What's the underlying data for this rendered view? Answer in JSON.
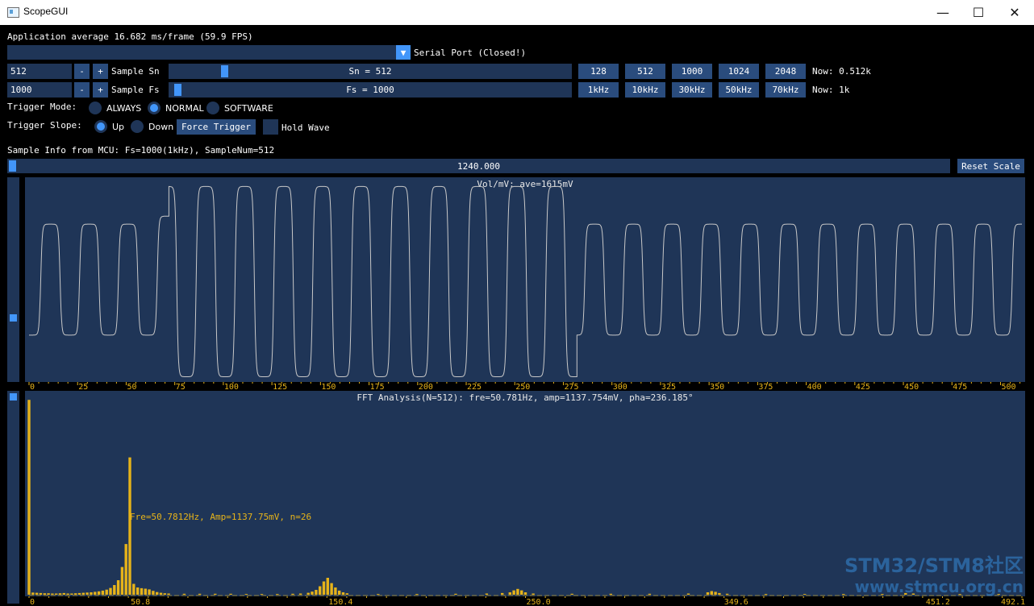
{
  "window": {
    "title": "ScopeGUI",
    "minimize_glyph": "—",
    "maximize_glyph": "☐",
    "close_glyph": "✕"
  },
  "header": {
    "fps_text": "Application average 16.682 ms/frame (59.9 FPS)"
  },
  "serial": {
    "combo_value": "",
    "arrow_glyph": "▼",
    "label": "Serial Port (Closed!)"
  },
  "sample_sn": {
    "value": "512",
    "minus": "-",
    "plus": "+",
    "label": "Sample Sn",
    "slider_text": "Sn = 512",
    "slider_fraction": 0.13,
    "presets": [
      "128",
      "512",
      "1000",
      "1024",
      "2048"
    ],
    "now_text": "Now: 0.512k"
  },
  "sample_fs": {
    "value": "1000",
    "minus": "-",
    "plus": "+",
    "label": "Sample Fs",
    "slider_text": "Fs = 1000",
    "slider_fraction": 0.01,
    "presets": [
      "1kHz",
      "10kHz",
      "30kHz",
      "50kHz",
      "70kHz"
    ],
    "now_text": "Now: 1k"
  },
  "trigger_mode": {
    "label": "Trigger Mode:",
    "options": [
      "ALWAYS",
      "NORMAL",
      "SOFTWARE"
    ],
    "selected": "NORMAL"
  },
  "trigger_slope": {
    "label": "Trigger Slope:",
    "options": [
      "Up",
      "Down"
    ],
    "selected": "Up",
    "force_button": "Force Trigger",
    "hold_label": "Hold Wave",
    "hold_checked": false
  },
  "sample_info": "Sample Info from MCU: Fs=1000(1kHz), SampleNum=512",
  "scale": {
    "slider_text": "1240.000",
    "slider_fraction": 0.0,
    "reset_button": "Reset Scale"
  },
  "colors": {
    "frame_bg": "#1f3557",
    "button": "#2a4c7d",
    "accent": "#4296fa",
    "plot_line": "#c8c8c8",
    "fft_bar": "#e6b31a"
  },
  "chart_data": [
    {
      "type": "line",
      "title": "Vol/mV: ave=1615mV",
      "x_ticks": [
        "0",
        "25",
        "50",
        "75",
        "100",
        "125",
        "150",
        "175",
        "200",
        "225",
        "250",
        "275",
        "300",
        "325",
        "350",
        "375",
        "400",
        "425",
        "450",
        "475",
        "500"
      ],
      "xlim": [
        0,
        511
      ],
      "series": [
        {
          "segments": [
            {
              "x_start": 0,
              "x_end": 62,
              "period": 20,
              "high": 0.78,
              "low": 0.22
            },
            {
              "x_start": 62,
              "x_end": 72,
              "period": 20,
              "high": 0.82,
              "low": 0.22
            },
            {
              "x_start": 72,
              "x_end": 282,
              "period": 20,
              "high": 0.97,
              "low": 0.01
            },
            {
              "x_start": 282,
              "x_end": 511,
              "period": 20,
              "high": 0.78,
              "low": 0.22
            }
          ]
        }
      ]
    },
    {
      "type": "bar",
      "title": "FFT Analysis(N=512): fre=50.781Hz, amp=1137.754mV, pha=236.185°",
      "annotation": "Fre=50.7812Hz, Amp=1137.75mV, n=26",
      "x_ticks": [
        "0",
        "50.8",
        "150.4",
        "250.0",
        "349.6",
        "451.2",
        "492.1"
      ],
      "xlim": [
        0,
        500
      ],
      "bins": [
        {
          "n": 0,
          "amp": 1615
        },
        {
          "n": 1,
          "amp": 18
        },
        {
          "n": 2,
          "amp": 16
        },
        {
          "n": 3,
          "amp": 14
        },
        {
          "n": 4,
          "amp": 12
        },
        {
          "n": 5,
          "amp": 12
        },
        {
          "n": 6,
          "amp": 10
        },
        {
          "n": 7,
          "amp": 10
        },
        {
          "n": 8,
          "amp": 12
        },
        {
          "n": 9,
          "amp": 14
        },
        {
          "n": 10,
          "amp": 10
        },
        {
          "n": 11,
          "amp": 10
        },
        {
          "n": 12,
          "amp": 12
        },
        {
          "n": 13,
          "amp": 14
        },
        {
          "n": 14,
          "amp": 16
        },
        {
          "n": 15,
          "amp": 18
        },
        {
          "n": 16,
          "amp": 20
        },
        {
          "n": 17,
          "amp": 24
        },
        {
          "n": 18,
          "amp": 28
        },
        {
          "n": 19,
          "amp": 34
        },
        {
          "n": 20,
          "amp": 42
        },
        {
          "n": 21,
          "amp": 56
        },
        {
          "n": 22,
          "amp": 80
        },
        {
          "n": 23,
          "amp": 120
        },
        {
          "n": 24,
          "amp": 230
        },
        {
          "n": 25,
          "amp": 420
        },
        {
          "n": 26,
          "amp": 1138
        },
        {
          "n": 27,
          "amp": 90
        },
        {
          "n": 28,
          "amp": 60
        },
        {
          "n": 29,
          "amp": 54
        },
        {
          "n": 30,
          "amp": 50
        },
        {
          "n": 31,
          "amp": 44
        },
        {
          "n": 32,
          "amp": 32
        },
        {
          "n": 33,
          "amp": 22
        },
        {
          "n": 34,
          "amp": 16
        },
        {
          "n": 35,
          "amp": 12
        },
        {
          "n": 36,
          "amp": 10
        },
        {
          "n": 40,
          "amp": 8
        },
        {
          "n": 44,
          "amp": 8
        },
        {
          "n": 48,
          "amp": 8
        },
        {
          "n": 52,
          "amp": 8
        },
        {
          "n": 56,
          "amp": 6
        },
        {
          "n": 60,
          "amp": 6
        },
        {
          "n": 64,
          "amp": 6
        },
        {
          "n": 68,
          "amp": 8
        },
        {
          "n": 70,
          "amp": 10
        },
        {
          "n": 72,
          "amp": 16
        },
        {
          "n": 73,
          "amp": 26
        },
        {
          "n": 74,
          "amp": 40
        },
        {
          "n": 75,
          "amp": 70
        },
        {
          "n": 76,
          "amp": 110
        },
        {
          "n": 77,
          "amp": 140
        },
        {
          "n": 78,
          "amp": 96
        },
        {
          "n": 79,
          "amp": 60
        },
        {
          "n": 80,
          "amp": 34
        },
        {
          "n": 81,
          "amp": 20
        },
        {
          "n": 82,
          "amp": 12
        },
        {
          "n": 90,
          "amp": 6
        },
        {
          "n": 100,
          "amp": 6
        },
        {
          "n": 110,
          "amp": 8
        },
        {
          "n": 118,
          "amp": 10
        },
        {
          "n": 122,
          "amp": 14
        },
        {
          "n": 124,
          "amp": 20
        },
        {
          "n": 125,
          "amp": 36
        },
        {
          "n": 126,
          "amp": 48
        },
        {
          "n": 127,
          "amp": 36
        },
        {
          "n": 128,
          "amp": 20
        },
        {
          "n": 130,
          "amp": 10
        },
        {
          "n": 140,
          "amp": 8
        },
        {
          "n": 150,
          "amp": 8
        },
        {
          "n": 160,
          "amp": 8
        },
        {
          "n": 170,
          "amp": 10
        },
        {
          "n": 175,
          "amp": 20
        },
        {
          "n": 176,
          "amp": 30
        },
        {
          "n": 177,
          "amp": 24
        },
        {
          "n": 178,
          "amp": 14
        },
        {
          "n": 180,
          "amp": 8
        },
        {
          "n": 190,
          "amp": 6
        },
        {
          "n": 200,
          "amp": 6
        },
        {
          "n": 210,
          "amp": 6
        },
        {
          "n": 220,
          "amp": 6
        },
        {
          "n": 226,
          "amp": 14
        },
        {
          "n": 228,
          "amp": 10
        },
        {
          "n": 240,
          "amp": 6
        },
        {
          "n": 250,
          "amp": 6
        }
      ]
    }
  ],
  "watermark": {
    "line1": "STM32/STM8社区",
    "line2": "www.stmcu.org.cn"
  }
}
